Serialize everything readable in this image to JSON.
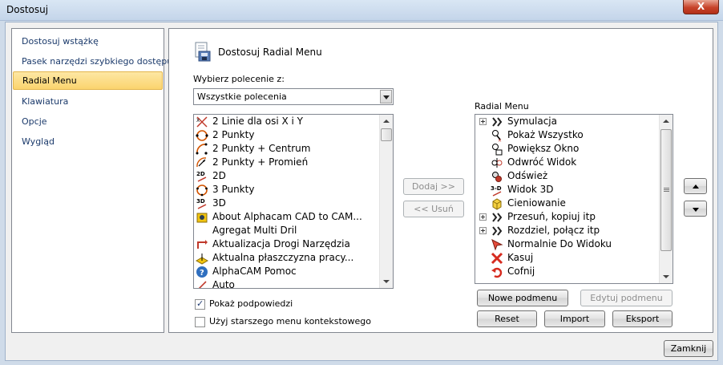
{
  "window": {
    "title": "Dostosuj",
    "close_glyph": "X"
  },
  "nav": {
    "items": [
      {
        "label": "Dostosuj wstążkę",
        "selected": false
      },
      {
        "label": "Pasek narzędzi szybkiego dostępu",
        "selected": false
      },
      {
        "label": "Radial Menu",
        "selected": true
      },
      {
        "label": "Klawiatura",
        "selected": false
      },
      {
        "label": "Opcje",
        "selected": false
      },
      {
        "label": "Wygląd",
        "selected": false
      }
    ]
  },
  "panel": {
    "title": "Dostosuj Radial Menu",
    "choose_label": "Wybierz polecenie z:",
    "combo_value": "Wszystkie polecenia",
    "commands": [
      {
        "label": "2 Linie dla osi X i Y",
        "icon": "lines-xy-icon"
      },
      {
        "label": "2 Punkty",
        "icon": "circle-2-points-icon"
      },
      {
        "label": "2 Punkty + Centrum",
        "icon": "arc-center-icon"
      },
      {
        "label": "2 Punkty + Promień",
        "icon": "arc-radius-icon"
      },
      {
        "label": "2D",
        "icon": "2d-icon"
      },
      {
        "label": "3 Punkty",
        "icon": "circle-3-points-icon"
      },
      {
        "label": "3D",
        "icon": "3d-icon"
      },
      {
        "label": "About Alphacam CAD to CAM...",
        "icon": "about-icon"
      },
      {
        "label": "Agregat Multi Dril",
        "icon": ""
      },
      {
        "label": "Aktualizacja Drogi Narzędzia",
        "icon": "toolpath-update-icon"
      },
      {
        "label": "Aktualna płaszczyzna pracy...",
        "icon": "work-plane-icon"
      },
      {
        "label": "AlphaCAM Pomoc",
        "icon": "help-icon"
      },
      {
        "label": "Auto",
        "icon": "auto-icon"
      }
    ],
    "add_button": "Dodaj >>",
    "remove_button": "<< Usuń",
    "radial_label": "Radial Menu",
    "radial_items": [
      {
        "label": "Symulacja",
        "icon": "double-chevron-icon",
        "expandable": true
      },
      {
        "label": "Pokaż Wszystko",
        "icon": "zoom-all-icon",
        "expandable": false
      },
      {
        "label": "Powiększ Okno",
        "icon": "zoom-window-icon",
        "expandable": false
      },
      {
        "label": "Odwróć Widok",
        "icon": "flip-view-icon",
        "expandable": false
      },
      {
        "label": "Odśwież",
        "icon": "refresh-icon",
        "expandable": false
      },
      {
        "label": "Widok 3D",
        "icon": "view-3d-icon",
        "expandable": false
      },
      {
        "label": "Cieniowanie",
        "icon": "shading-cube-icon",
        "expandable": false
      },
      {
        "label": "Przesuń, kopiuj itp",
        "icon": "double-chevron-icon",
        "expandable": true
      },
      {
        "label": "Rozdziel, połącz itp",
        "icon": "double-chevron-icon",
        "expandable": true
      },
      {
        "label": "Normalnie Do Widoku",
        "icon": "normal-view-icon",
        "expandable": false
      },
      {
        "label": "Kasuj",
        "icon": "delete-x-icon",
        "expandable": false
      },
      {
        "label": "Cofnij",
        "icon": "undo-icon",
        "expandable": false
      }
    ],
    "new_submenu": "Nowe podmenu",
    "edit_submenu": "Edytuj podmenu",
    "reset": "Reset",
    "import": "Import",
    "export": "Eksport",
    "show_tips": "Pokaż podpowiedzi",
    "show_tips_checked": true,
    "legacy_menu": "Użyj starszego menu kontekstowego",
    "legacy_menu_checked": false
  },
  "footer": {
    "close_button": "Zamknij"
  }
}
